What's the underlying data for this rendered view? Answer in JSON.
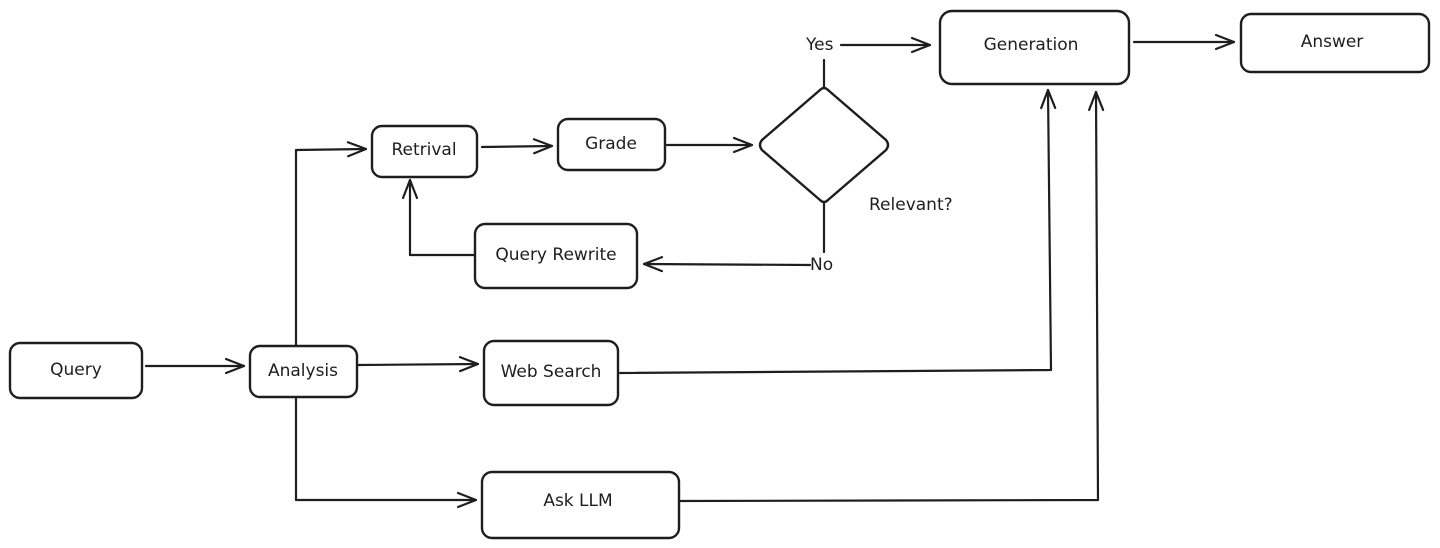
{
  "diagram": {
    "type": "flowchart",
    "nodes": [
      {
        "id": "query",
        "label": "Query",
        "shape": "rounded-rect"
      },
      {
        "id": "analysis",
        "label": "Analysis",
        "shape": "rounded-rect"
      },
      {
        "id": "retrival",
        "label": "Retrival",
        "shape": "rounded-rect"
      },
      {
        "id": "grade",
        "label": "Grade",
        "shape": "rounded-rect"
      },
      {
        "id": "decision",
        "label": "",
        "shape": "diamond"
      },
      {
        "id": "query_rewrite",
        "label": "Query Rewrite",
        "shape": "rounded-rect"
      },
      {
        "id": "web_search",
        "label": "Web Search",
        "shape": "rounded-rect"
      },
      {
        "id": "ask_llm",
        "label": "Ask LLM",
        "shape": "rounded-rect"
      },
      {
        "id": "generation",
        "label": "Generation",
        "shape": "rounded-rect"
      },
      {
        "id": "answer",
        "label": "Answer",
        "shape": "rounded-rect"
      }
    ],
    "edges": [
      {
        "from": "query",
        "to": "analysis",
        "label": ""
      },
      {
        "from": "analysis",
        "to": "retrival",
        "label": ""
      },
      {
        "from": "analysis",
        "to": "web_search",
        "label": ""
      },
      {
        "from": "analysis",
        "to": "ask_llm",
        "label": ""
      },
      {
        "from": "retrival",
        "to": "grade",
        "label": ""
      },
      {
        "from": "grade",
        "to": "decision",
        "label": ""
      },
      {
        "from": "decision",
        "to": "generation",
        "label": "Yes"
      },
      {
        "from": "decision",
        "to": "query_rewrite",
        "label": "No"
      },
      {
        "from": "query_rewrite",
        "to": "retrival",
        "label": ""
      },
      {
        "from": "web_search",
        "to": "generation",
        "label": ""
      },
      {
        "from": "ask_llm",
        "to": "generation",
        "label": ""
      },
      {
        "from": "generation",
        "to": "answer",
        "label": ""
      }
    ],
    "annotations": {
      "decision_question": "Relevant?",
      "yes_label": "Yes",
      "no_label": "No"
    },
    "colors": {
      "stroke": "#1e1e1e",
      "background": "#ffffff"
    }
  }
}
